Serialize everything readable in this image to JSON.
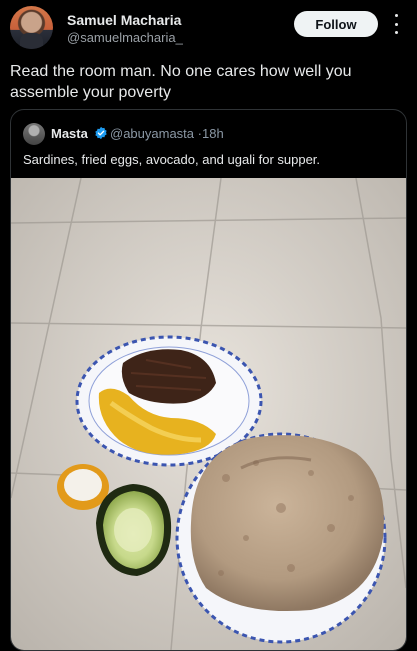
{
  "post": {
    "author_name": "Samuel Macharia",
    "author_handle": "@samuelmacharia_",
    "follow_label": "Follow",
    "text": "Read the room man. No one cares how well you assemble your poverty"
  },
  "quoted_post": {
    "author_name": "Masta",
    "author_handle": "@abuyamasta",
    "separator": "·",
    "time": "18h",
    "text": "Sardines, fried eggs, avocado, and ugali for supper."
  },
  "icons": {
    "more": "more-options-icon",
    "verified": "verified-badge-icon"
  },
  "colors": {
    "background": "#000000",
    "text": "#e7e9ea",
    "muted": "#9aa0a6",
    "verified": "#1d9bf0",
    "follow_bg": "#eff3f4"
  }
}
